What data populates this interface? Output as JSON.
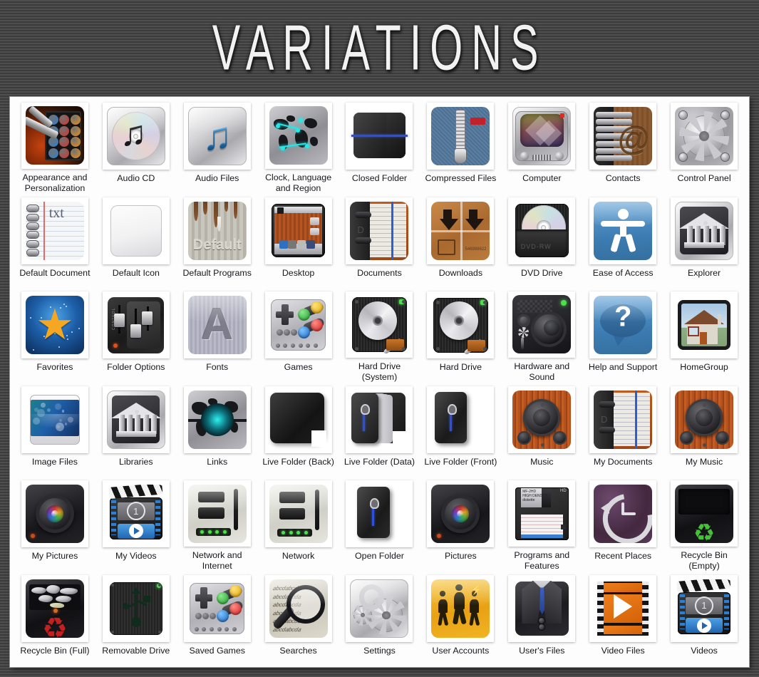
{
  "title": "VARIATIONS",
  "icons": [
    {
      "label": "Appearance and Personalization",
      "art": "appearance"
    },
    {
      "label": "Audio CD",
      "art": "audio-cd"
    },
    {
      "label": "Audio Files",
      "art": "audio-files"
    },
    {
      "label": "Clock, Language and Region",
      "art": "clock-language"
    },
    {
      "label": "Closed Folder",
      "art": "closed-folder"
    },
    {
      "label": "Compressed Files",
      "art": "compressed-files"
    },
    {
      "label": "Computer",
      "art": "computer"
    },
    {
      "label": "Contacts",
      "art": "contacts"
    },
    {
      "label": "Control Panel",
      "art": "control-panel"
    },
    {
      "label": "Default Document",
      "art": "default-document"
    },
    {
      "label": "Default Icon",
      "art": "default-icon"
    },
    {
      "label": "Default Programs",
      "art": "default-programs"
    },
    {
      "label": "Desktop",
      "art": "desktop"
    },
    {
      "label": "Documents",
      "art": "documents"
    },
    {
      "label": "Downloads",
      "art": "downloads"
    },
    {
      "label": "DVD Drive",
      "art": "dvd-drive"
    },
    {
      "label": "Ease of Access",
      "art": "ease-of-access"
    },
    {
      "label": "Explorer",
      "art": "explorer"
    },
    {
      "label": "Favorites",
      "art": "favorites"
    },
    {
      "label": "Folder Options",
      "art": "folder-options"
    },
    {
      "label": "Fonts",
      "art": "fonts"
    },
    {
      "label": "Games",
      "art": "games"
    },
    {
      "label": "Hard Drive (System)",
      "art": "hard-drive"
    },
    {
      "label": "Hard Drive",
      "art": "hard-drive"
    },
    {
      "label": "Hardware and Sound",
      "art": "hardware-sound"
    },
    {
      "label": "Help and Support",
      "art": "help-support"
    },
    {
      "label": "HomeGroup",
      "art": "homegroup"
    },
    {
      "label": "Image Files",
      "art": "image-files"
    },
    {
      "label": "Libraries",
      "art": "libraries"
    },
    {
      "label": "Links",
      "art": "links"
    },
    {
      "label": "Live Folder (Back)",
      "art": "live-folder-back"
    },
    {
      "label": "Live Folder (Data)",
      "art": "live-folder-data"
    },
    {
      "label": "Live Folder (Front)",
      "art": "live-folder-front"
    },
    {
      "label": "Music",
      "art": "music"
    },
    {
      "label": "My Documents",
      "art": "my-documents"
    },
    {
      "label": "My Music",
      "art": "music"
    },
    {
      "label": "My Pictures",
      "art": "camera"
    },
    {
      "label": "My Videos",
      "art": "clapper"
    },
    {
      "label": "Network and Internet",
      "art": "network-internet"
    },
    {
      "label": "Network",
      "art": "network"
    },
    {
      "label": "Open Folder",
      "art": "open-folder"
    },
    {
      "label": "Pictures",
      "art": "camera"
    },
    {
      "label": "Programs and Features",
      "art": "programs-features"
    },
    {
      "label": "Recent Places",
      "art": "recent-places"
    },
    {
      "label": "Recycle Bin (Empty)",
      "art": "recycle-empty"
    },
    {
      "label": "Recycle Bin (Full)",
      "art": "recycle-full"
    },
    {
      "label": "Removable Drive",
      "art": "removable-drive"
    },
    {
      "label": "Saved Games",
      "art": "games"
    },
    {
      "label": "Searches",
      "art": "searches"
    },
    {
      "label": "Settings",
      "art": "settings"
    },
    {
      "label": "User Accounts",
      "art": "user-accounts"
    },
    {
      "label": "User's Files",
      "art": "users-files"
    },
    {
      "label": "Video Files",
      "art": "video-files"
    },
    {
      "label": "Videos",
      "art": "clapper"
    }
  ],
  "colors": {
    "frame_dark": "#3c3c3c",
    "frame_light": "#4f4f4f",
    "panel_bg": "#fdfdfd",
    "label_text": "#17171d",
    "title_text": "#f2f2f2",
    "accent_blue": "#2f4fd8",
    "accent_orange": "#ee7f1d",
    "accent_yellow": "#f7c437",
    "accent_red": "#c42020",
    "accent_green": "#4ce04c"
  },
  "grid": {
    "columns": 9,
    "rows": 6,
    "total": 54
  },
  "programs_features_label_text": "MF-2HD",
  "default_programs_text": "Default",
  "default_document_text": "txt",
  "dvd_drive_text": "DVD-RW"
}
